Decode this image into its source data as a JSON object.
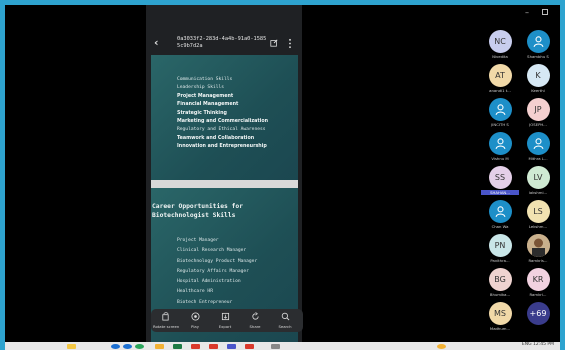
{
  "viewer": {
    "file_name": "0a3033f2-283d-4a4b-91a0-15855c9b7d2a"
  },
  "slide1": {
    "items": [
      "Communication Skills",
      "Leadership Skills",
      "Project Management",
      "Financial Management",
      "Strategic Thinking",
      "Marketing and Commercialization",
      "Regulatory and Ethical Awareness",
      "Teamwork and Collaboration",
      "Innovation and Entrepreneurship"
    ]
  },
  "slide2": {
    "title": "Career Opportunities for Biotechnologist Skills",
    "items": [
      "Project Manager",
      "Clinical Research Manager",
      "Biotechnology Product Manager",
      "Regulatory Affairs Manager",
      "Hospital Administration",
      "Healthcare HR",
      "Biotech Entrepreneur"
    ]
  },
  "actions": [
    {
      "label": "Rotate screen",
      "icon": "rotate-screen-icon"
    },
    {
      "label": "Play",
      "icon": "play-icon"
    },
    {
      "label": "Export",
      "icon": "export-icon"
    },
    {
      "label": "Share",
      "icon": "share-icon"
    },
    {
      "label": "Search",
      "icon": "search-icon"
    }
  ],
  "participants": [
    {
      "initials": "NC",
      "name": "Nivedita",
      "color": "#c8cdee"
    },
    {
      "initials": "",
      "name": "Shambhu S",
      "color": "#1d8fc8",
      "icon": "person-icon"
    },
    {
      "initials": "AT",
      "name": "anandi1 t...",
      "color": "#f1d9a8"
    },
    {
      "initials": "K",
      "name": "Keerthi",
      "color": "#d6e8f4"
    },
    {
      "initials": "",
      "name": "JINCITH S",
      "color": "#1d8fc8",
      "icon": "person-icon"
    },
    {
      "initials": "JP",
      "name": "JOSEPH...",
      "color": "#f4cfcf"
    },
    {
      "initials": "",
      "name": "Vishnu M",
      "color": "#1d8fc8",
      "icon": "person-icon"
    },
    {
      "initials": "",
      "name": "Mithra L...",
      "color": "#1d8fc8",
      "icon": "person-icon"
    },
    {
      "initials": "SS",
      "name": "SHAHAN...",
      "color": "#e4cfe8",
      "highlight": true
    },
    {
      "initials": "LV",
      "name": "lakshmi...",
      "color": "#cfead3"
    },
    {
      "initials": "",
      "name": "Chan Wa",
      "color": "#1d8fc8",
      "icon": "person-icon"
    },
    {
      "initials": "LS",
      "name": "Lekshm...",
      "color": "#f1e2b1"
    },
    {
      "initials": "PN",
      "name": "Pavithra...",
      "color": "#c9e6e8"
    },
    {
      "initials": "",
      "name": "Ramkris...",
      "color": "#b39572",
      "icon": "photo-avatar"
    },
    {
      "initials": "BG",
      "name": "Bhumika...",
      "color": "#efd3d0"
    },
    {
      "initials": "KR",
      "name": "Ramkri...",
      "color": "#f1d1e0"
    },
    {
      "initials": "MS",
      "name": "Madhum...",
      "color": "#f1d9a8"
    },
    {
      "initials": "+69",
      "name": "",
      "color": "#3a3c8c",
      "text_color": "#ffffff"
    }
  ],
  "taskbar": {
    "tray_text": "ENG   12:45 PM"
  }
}
